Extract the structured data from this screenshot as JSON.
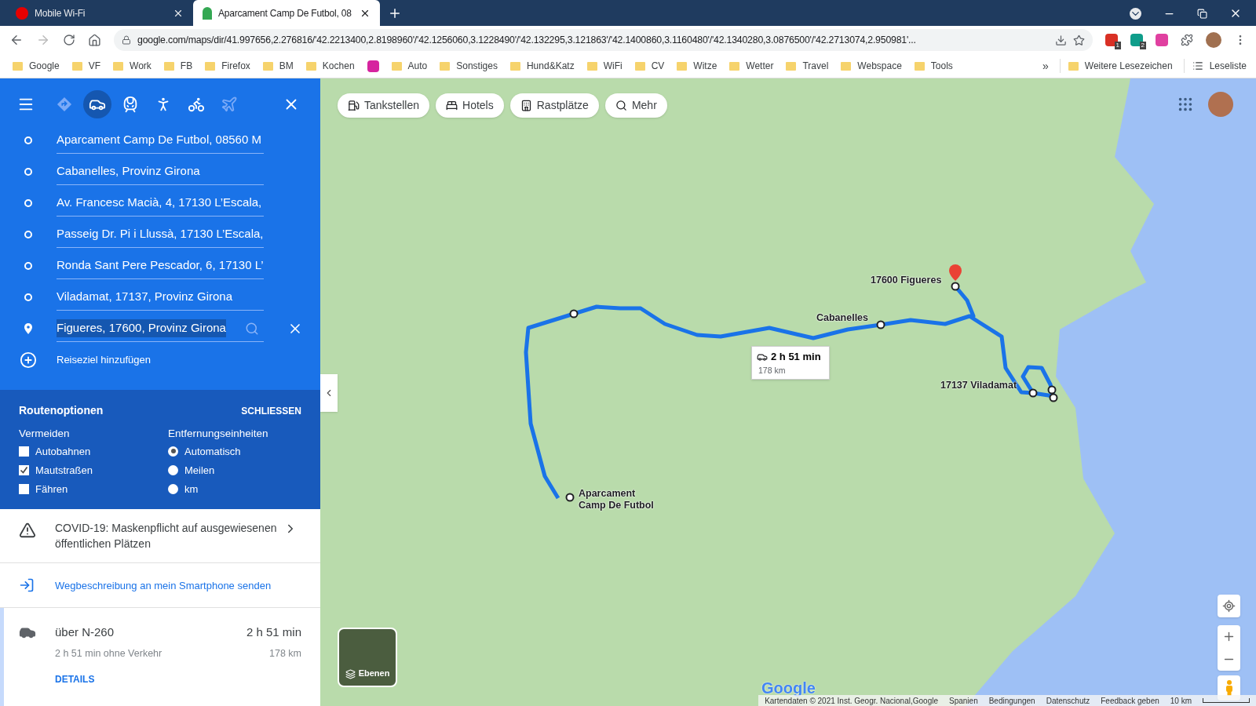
{
  "browser": {
    "tabs": [
      {
        "title": "Mobile Wi-Fi",
        "kind": "vodafone",
        "selected": false
      },
      {
        "title": "Aparcament Camp De Futbol, 08",
        "kind": "maps",
        "selected": true
      }
    ],
    "url": "google.com/maps/dir/41.997656,2.276816/'42.2213400,2.8198960'/'42.1256060,3.1228490'/'42.132295,3.121863'/'42.1400860,3.1160480'/'42.1340280,3.0876500'/'42.2713074,2.950981'...",
    "extensions": [
      {
        "kind": "red",
        "badge": "1"
      },
      {
        "kind": "teal",
        "badge": "2"
      },
      {
        "kind": "pink"
      }
    ],
    "bookmarks": [
      {
        "kind": "folder",
        "label": "Google"
      },
      {
        "kind": "folder",
        "label": "VF"
      },
      {
        "kind": "folder",
        "label": "Work"
      },
      {
        "kind": "folder",
        "label": "FB"
      },
      {
        "kind": "folder",
        "label": "Firefox"
      },
      {
        "kind": "folder",
        "label": "BM"
      },
      {
        "kind": "folder",
        "label": "Kochen"
      },
      {
        "kind": "instagram"
      },
      {
        "kind": "folder",
        "label": "Auto"
      },
      {
        "kind": "folder",
        "label": "Sonstiges"
      },
      {
        "kind": "folder",
        "label": "Hund&Katz"
      },
      {
        "kind": "folder",
        "label": "WiFi"
      },
      {
        "kind": "folder",
        "label": "CV"
      },
      {
        "kind": "folder",
        "label": "Witze"
      },
      {
        "kind": "folder",
        "label": "Wetter"
      },
      {
        "kind": "folder",
        "label": "Travel"
      },
      {
        "kind": "folder",
        "label": "Webspace"
      },
      {
        "kind": "folder",
        "label": "Tools"
      }
    ],
    "overflow": "»",
    "other_bookmarks": "Weitere Lesezeichen",
    "reading_list": "Leseliste"
  },
  "sidebar": {
    "travel_modes": [
      {
        "kind": "best",
        "selected": false,
        "disabled": true
      },
      {
        "kind": "car",
        "selected": true,
        "disabled": false
      },
      {
        "kind": "transit",
        "selected": false,
        "disabled": false
      },
      {
        "kind": "walking",
        "selected": false,
        "disabled": false
      },
      {
        "kind": "cycling",
        "selected": false,
        "disabled": false
      },
      {
        "kind": "flight",
        "selected": false,
        "disabled": true
      }
    ],
    "waypoints": [
      {
        "kind": "stop",
        "text": "Aparcament Camp De Futbol, 08560 M",
        "text_selected": false
      },
      {
        "kind": "stop",
        "text": "Cabanelles, Provinz Girona",
        "text_selected": false
      },
      {
        "kind": "stop",
        "text": "Av. Francesc Macià, 4, 17130 L’Escala,",
        "text_selected": false
      },
      {
        "kind": "stop",
        "text": "Passeig Dr. Pi i Llussà, 17130 L’Escala,",
        "text_selected": false
      },
      {
        "kind": "stop",
        "text": "Ronda Sant Pere Pescador, 6, 17130 L’",
        "text_selected": false
      },
      {
        "kind": "stop",
        "text": "Viladamat, 17137, Provinz Girona",
        "text_selected": false
      },
      {
        "kind": "destination",
        "text": "Figueres, 17600, Provinz Girona",
        "text_selected": true
      }
    ],
    "add_destination": "Reiseziel hinzufügen",
    "route_options": {
      "title": "Routenoptionen",
      "close": "SCHLIESSEN",
      "avoid": {
        "heading": "Vermeiden",
        "items": [
          {
            "label": "Autobahnen",
            "checked": false
          },
          {
            "label": "Mautstraßen",
            "checked": true
          },
          {
            "label": "Fähren",
            "checked": false
          }
        ]
      },
      "units": {
        "heading": "Entfernungseinheiten",
        "items": [
          {
            "label": "Automatisch",
            "selected": true
          },
          {
            "label": "Meilen",
            "selected": false
          },
          {
            "label": "km",
            "selected": false
          }
        ]
      }
    },
    "notice": "COVID-19: Maskenpflicht auf ausgewiesenen öffentlichen Plätzen",
    "send_link": "Wegbeschreibung an mein Smartphone senden",
    "route": {
      "via": "über N-260",
      "duration": "2 h 51 min",
      "detail": "2 h 51 min ohne Verkehr",
      "distance": "178 km",
      "details_link": "DETAILS",
      "selected": true
    }
  },
  "map": {
    "chips": [
      {
        "kind": "fuel",
        "label": "Tankstellen"
      },
      {
        "kind": "hotel",
        "label": "Hotels"
      },
      {
        "kind": "rest",
        "label": "Rastplätze"
      },
      {
        "kind": "search",
        "label": "Mehr"
      }
    ],
    "labels": [
      {
        "lines": [
          "17600 Figueres"
        ]
      },
      {
        "lines": [
          "Cabanelles"
        ]
      },
      {
        "lines": [
          "17137 Viladamat"
        ]
      },
      {
        "lines": [
          "Aparcament",
          "Camp De Futbol"
        ]
      }
    ],
    "callout": {
      "duration": "2 h 51 min",
      "distance": "178 km"
    },
    "layers": "Ebenen",
    "logo": "Google",
    "footer": [
      "Kartendaten © 2021 Inst. Geogr. Nacional,Google",
      "Spanien",
      "Bedingungen",
      "Datenschutz",
      "Feedback geben"
    ],
    "scale": "10 km"
  }
}
